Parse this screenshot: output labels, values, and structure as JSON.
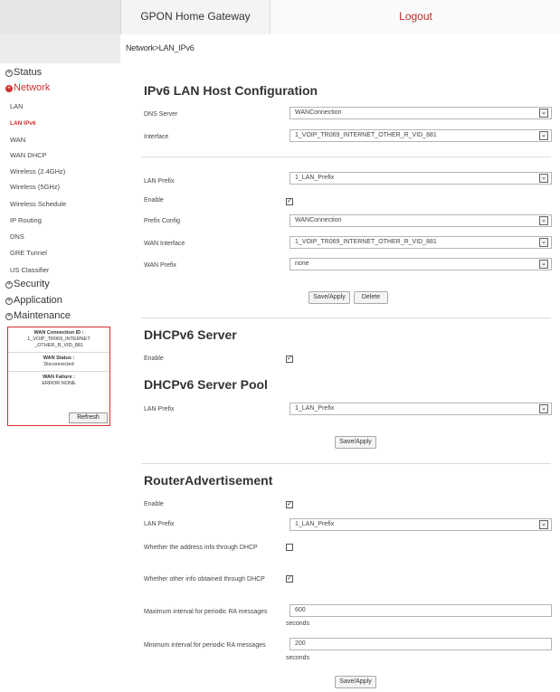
{
  "header": {
    "tab_label": "GPON Home Gateway",
    "logout_label": "Logout",
    "breadcrumb": "Network>LAN_IPv6"
  },
  "sidebar": {
    "menus": {
      "status": "Status",
      "network": "Network",
      "security": "Security",
      "application": "Application",
      "maintenance": "Maintenance"
    },
    "network_items": [
      "LAN",
      "LAN IPv6",
      "WAN",
      "WAN DHCP",
      "Wireless (2.4GHz)",
      "Wireless (5GHz)",
      "Wireless Schedule",
      "IP Routing",
      "DNS",
      "GRE Tunnel",
      "US Classifier"
    ],
    "status_panel": {
      "wan_conn_label": "WAN Connection ID :",
      "wan_conn_value": "1_VOIP_TR069_INTERNET _OTHER_R_VID_881",
      "wan_status_label": "WAN Status :",
      "wan_status_value": "Disconnected",
      "wan_failure_label": "WAN Failure :",
      "wan_failure_value": "ERROR NONE",
      "refresh_label": "Refresh"
    }
  },
  "ipv6_lan": {
    "title": "IPv6 LAN Host Configuration",
    "dns_server_label": "DNS Server",
    "dns_server_value": "WANConnection",
    "interface_label": "Interface",
    "interface_value": "1_VOIP_TR069_INTERNET_OTHER_R_VID_881",
    "lan_prefix_label": "LAN Prefix",
    "lan_prefix_value": "1_LAN_Prefix",
    "enable_label": "Enable",
    "prefix_config_label": "Prefix Config",
    "prefix_config_value": "WANConnection",
    "wan_interface_label": "WAN Interface",
    "wan_interface_value": "1_VOIP_TR069_INTERNET_OTHER_R_VID_881",
    "wan_prefix_label": "WAN Prefix",
    "wan_prefix_value": "none",
    "save_label": "Save/Apply",
    "delete_label": "Delete"
  },
  "dhcpv6": {
    "title": "DHCPv6 Server",
    "enable_label": "Enable",
    "pool_title": "DHCPv6 Server Pool",
    "lan_prefix_label": "LAN Prefix",
    "lan_prefix_value": "1_LAN_Prefix",
    "save_label": "Save/Apply"
  },
  "router_adv": {
    "title": "RouterAdvertisement",
    "enable_label": "Enable",
    "lan_prefix_label": "LAN Prefix",
    "lan_prefix_value": "1_LAN_Prefix",
    "address_dhcp_label": "Whether the address info through DHCP",
    "other_dhcp_label": "Whether other info obtained through DHCP",
    "max_interval_label": "Maximum interval for periodic RA messages",
    "max_interval_value": "600",
    "min_interval_label": "Minimum interval for periodic RA messages",
    "min_interval_value": "200",
    "seconds_label": "seconds",
    "save_label": "Save/Apply"
  },
  "icons": {
    "check": "✓",
    "dropdown": "⌄",
    "plus": "+"
  }
}
